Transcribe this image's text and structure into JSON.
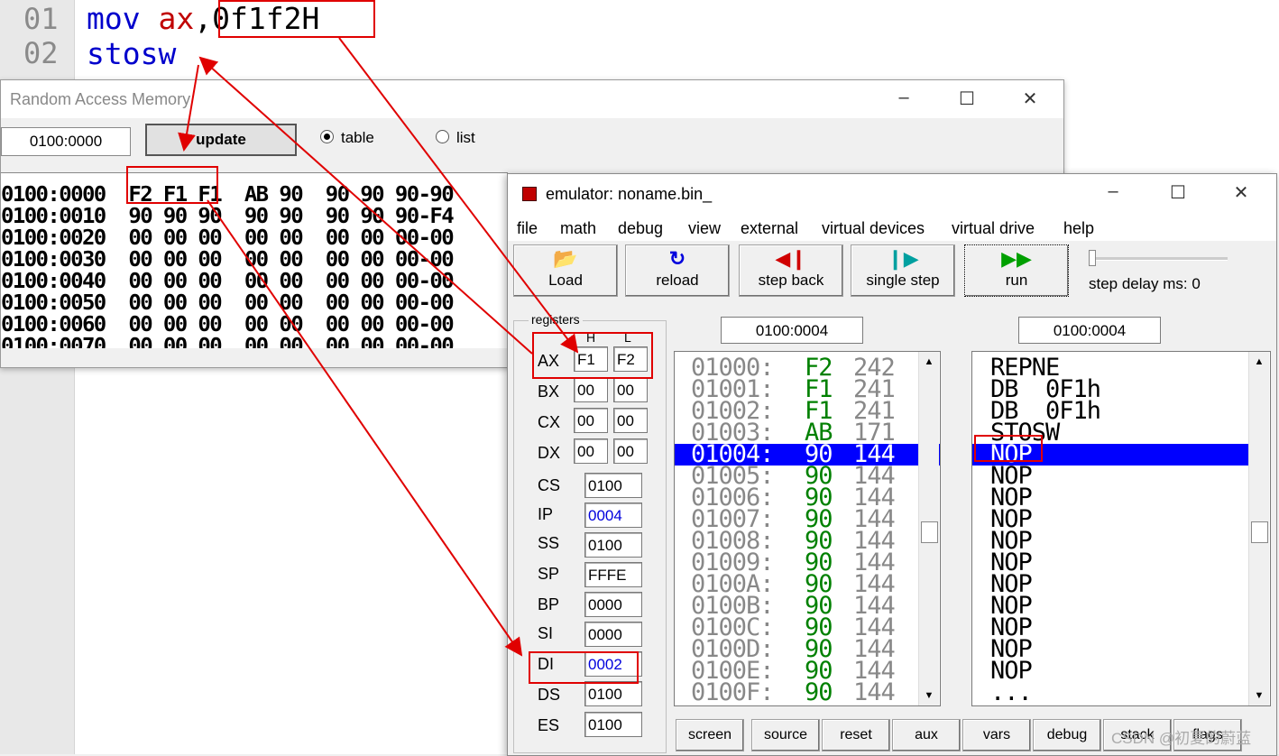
{
  "editor": {
    "lines": [
      {
        "num": "01",
        "parts": [
          "mov",
          "ax",
          ",",
          "0f1f2H"
        ]
      },
      {
        "num": "02",
        "parts": [
          "stosw"
        ]
      }
    ]
  },
  "ram_window": {
    "title": "Random Access Memory",
    "address_value": "0100:0000",
    "update_label": "update",
    "radio_table": "table",
    "radio_list": "list",
    "selected_view": "table",
    "rows": [
      "0100:0000  F2 F1 F1  AB 90  90 90 90-90",
      "0100:0010  90 90 90  90 90  90 90 90-F4",
      "0100:0020  00 00 00  00 00  00 00 00-00",
      "0100:0030  00 00 00  00 00  00 00 00-00",
      "0100:0040  00 00 00  00 00  00 00 00-00",
      "0100:0050  00 00 00  00 00  00 00 00-00",
      "0100:0060  00 00 00  00 00  00 00 00-00",
      "0100:0070  00 00 00  00 00  00 00 00-00"
    ]
  },
  "emulator": {
    "title": "emulator: noname.bin_",
    "menu": [
      "file",
      "math",
      "debug",
      "view",
      "external",
      "virtual devices",
      "virtual drive",
      "help"
    ],
    "toolbar": {
      "load": "Load",
      "reload": "reload",
      "step_back": "step back",
      "single_step": "single step",
      "run": "run",
      "step_delay_label": "step delay ms: 0",
      "step_delay_value": 0
    },
    "registers": {
      "legend": "registers",
      "h_label": "H",
      "l_label": "L",
      "split": [
        {
          "name": "AX",
          "h": "F1",
          "l": "F2"
        },
        {
          "name": "BX",
          "h": "00",
          "l": "00"
        },
        {
          "name": "CX",
          "h": "00",
          "l": "00"
        },
        {
          "name": "DX",
          "h": "00",
          "l": "00"
        }
      ],
      "full": [
        {
          "name": "CS",
          "value": "0100",
          "changed": false
        },
        {
          "name": "IP",
          "value": "0004",
          "changed": true
        },
        {
          "name": "SS",
          "value": "0100",
          "changed": false
        },
        {
          "name": "SP",
          "value": "FFFE",
          "changed": false
        },
        {
          "name": "BP",
          "value": "0000",
          "changed": false
        },
        {
          "name": "SI",
          "value": "0000",
          "changed": false
        },
        {
          "name": "DI",
          "value": "0002",
          "changed": true
        },
        {
          "name": "DS",
          "value": "0100",
          "changed": false
        },
        {
          "name": "ES",
          "value": "0100",
          "changed": false
        }
      ]
    },
    "mem_address": "0100:0004",
    "dis_address": "0100:0004",
    "memory": [
      {
        "addr": "01000:",
        "hex": "F2",
        "dec": "242",
        "chr": "?"
      },
      {
        "addr": "01001:",
        "hex": "F1",
        "dec": "241",
        "chr": "?"
      },
      {
        "addr": "01002:",
        "hex": "F1",
        "dec": "241",
        "chr": "?"
      },
      {
        "addr": "01003:",
        "hex": "AB",
        "dec": "171",
        "chr": "?"
      },
      {
        "addr": "01004:",
        "hex": "90",
        "dec": "144",
        "chr": "?"
      },
      {
        "addr": "01005:",
        "hex": "90",
        "dec": "144",
        "chr": "?"
      },
      {
        "addr": "01006:",
        "hex": "90",
        "dec": "144",
        "chr": "?"
      },
      {
        "addr": "01007:",
        "hex": "90",
        "dec": "144",
        "chr": "?"
      },
      {
        "addr": "01008:",
        "hex": "90",
        "dec": "144",
        "chr": "?"
      },
      {
        "addr": "01009:",
        "hex": "90",
        "dec": "144",
        "chr": "?"
      },
      {
        "addr": "0100A:",
        "hex": "90",
        "dec": "144",
        "chr": "?"
      },
      {
        "addr": "0100B:",
        "hex": "90",
        "dec": "144",
        "chr": "?"
      },
      {
        "addr": "0100C:",
        "hex": "90",
        "dec": "144",
        "chr": "?"
      },
      {
        "addr": "0100D:",
        "hex": "90",
        "dec": "144",
        "chr": "?"
      },
      {
        "addr": "0100E:",
        "hex": "90",
        "dec": "144",
        "chr": "?"
      },
      {
        "addr": "0100F:",
        "hex": "90",
        "dec": "144",
        "chr": "?"
      }
    ],
    "selected_row": 4,
    "disassembly": [
      "REPNE",
      "DB  0F1h",
      "DB  0F1h",
      "STOSW",
      "NOP",
      "NOP",
      "NOP",
      "NOP",
      "NOP",
      "NOP",
      "NOP",
      "NOP",
      "NOP",
      "NOP",
      "NOP",
      "..."
    ],
    "bottom_buttons": [
      "screen",
      "source",
      "reset",
      "aux",
      "vars",
      "debug",
      "stack",
      "flags"
    ]
  },
  "watermark": "CSDN @初夏的蔚蓝",
  "colors": {
    "highlight": "#0000ff",
    "annotation": "#e00000",
    "keyword": "#0000cc",
    "register": "#c00000"
  }
}
